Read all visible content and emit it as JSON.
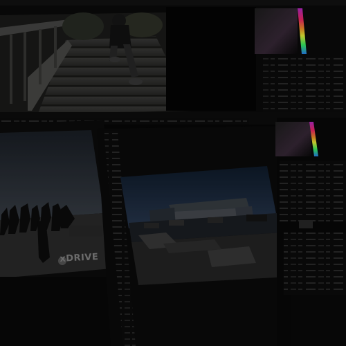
{
  "scene": {
    "description_free": true,
    "windows": [
      {
        "id": "top-window",
        "content": "stair-photo"
      },
      {
        "id": "bottom-left-window",
        "content": "group-photo"
      },
      {
        "id": "bottom-right-window",
        "content": "building-photo"
      }
    ],
    "caption_text": "xDRIVE",
    "colors": {
      "background": "#070707",
      "window_frame": "#1a1a1a",
      "panel": "#0f0f0f",
      "sky_dark": "#1b2a3c",
      "sky_left": "#2a3038",
      "ground": "#262626",
      "spectrum": [
        "#c02bd1",
        "#ff2a6a",
        "#ff9a2a",
        "#f6ff3a",
        "#3aff6a",
        "#2a8bff"
      ]
    }
  }
}
